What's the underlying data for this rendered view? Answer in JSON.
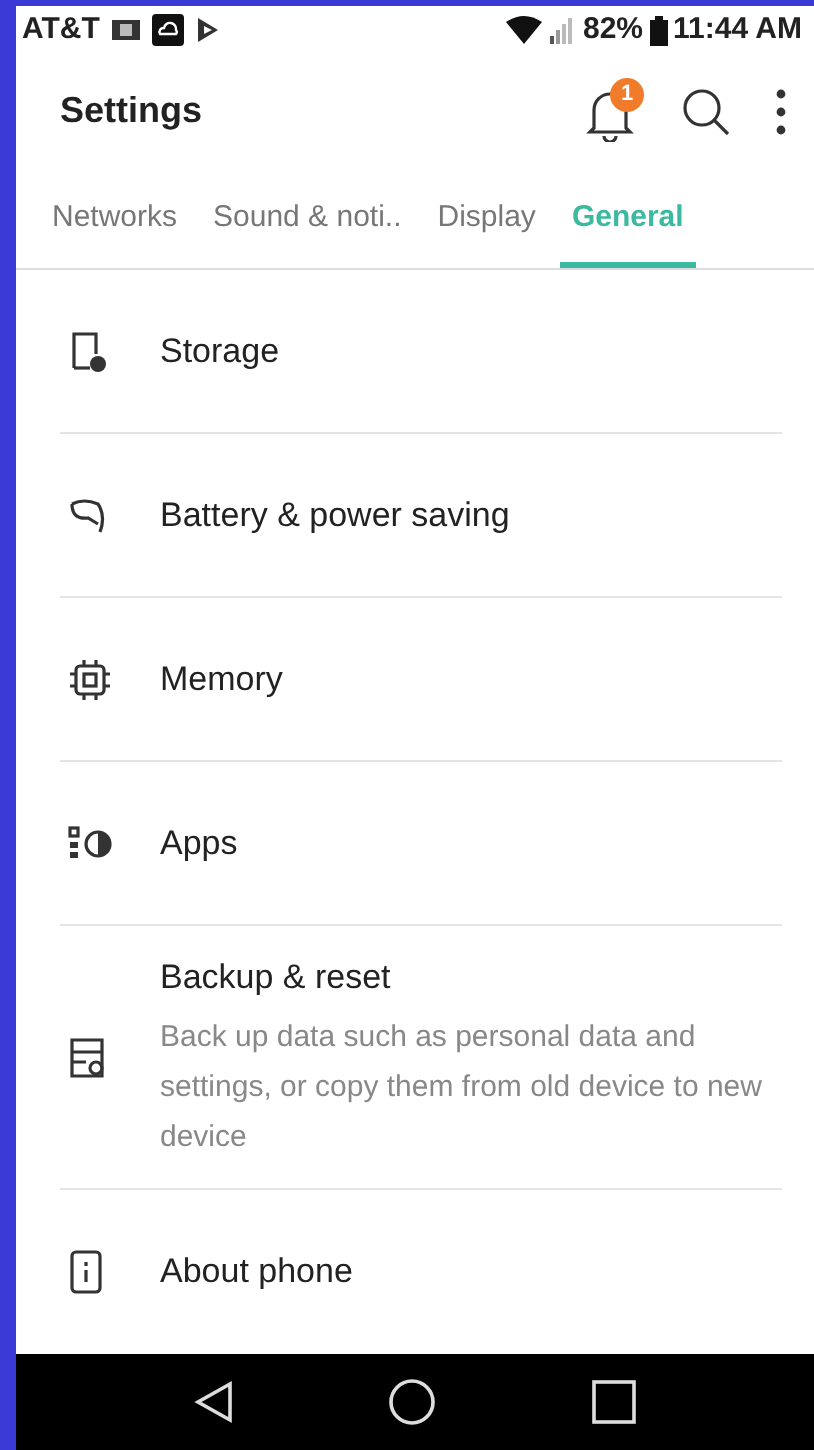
{
  "status_bar": {
    "carrier": "AT&T",
    "battery_percent": "82%",
    "time": "11:44 AM"
  },
  "header": {
    "title": "Settings",
    "notification_badge": "1"
  },
  "tabs": [
    {
      "label": "Networks",
      "selected": false
    },
    {
      "label": "Sound & noti..",
      "selected": false
    },
    {
      "label": "Display",
      "selected": false
    },
    {
      "label": "General",
      "selected": true
    }
  ],
  "items": [
    {
      "title": "Storage"
    },
    {
      "title": "Battery & power saving"
    },
    {
      "title": "Memory"
    },
    {
      "title": "Apps"
    },
    {
      "title": "Backup & reset",
      "description": "Back up data such as personal data and settings, or copy them from old device to new device"
    },
    {
      "title": "About phone"
    }
  ]
}
